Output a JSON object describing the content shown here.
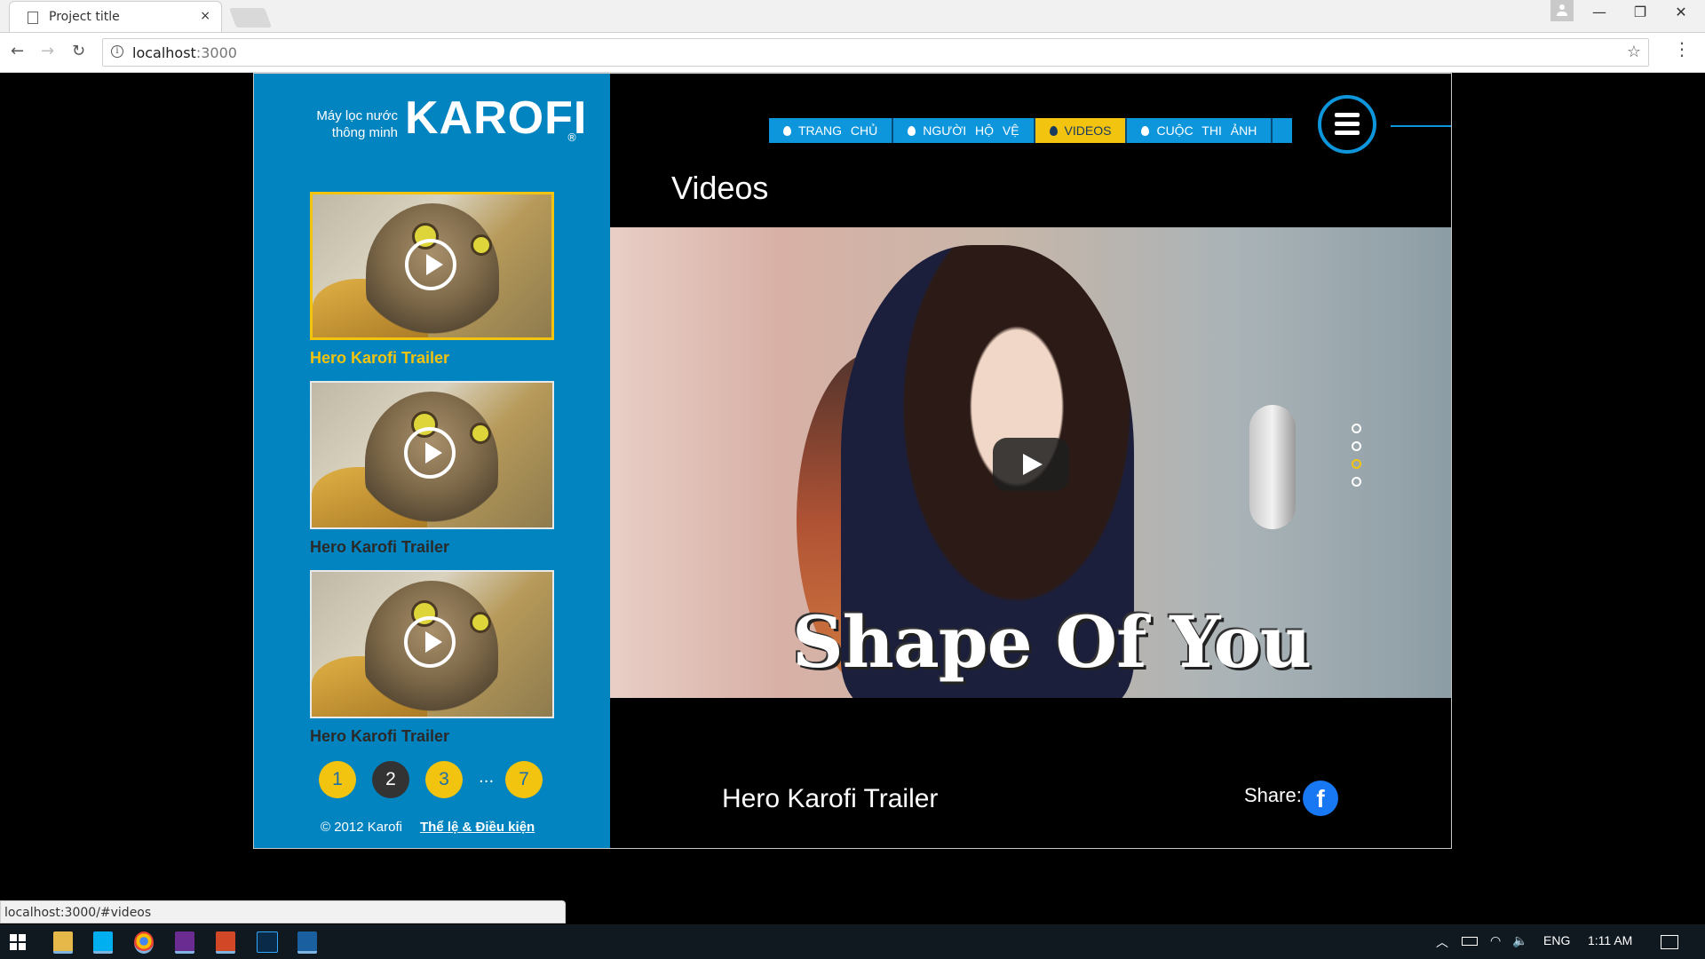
{
  "browser": {
    "tab_title": "Project title",
    "tab_close": "×",
    "url_host": "localhost",
    "url_port": ":3000",
    "win_minimize": "—",
    "win_restore": "❐",
    "win_close": "✕",
    "back": "←",
    "forward": "→",
    "reload": "↻",
    "star": "☆",
    "menu": "⋮",
    "status_url": "localhost:3000/#videos"
  },
  "logo": {
    "sub_line1": "Máy lọc nước",
    "sub_line2": "thông minh",
    "brand": "KAROFI",
    "reg": "®"
  },
  "sidebar": {
    "videos": [
      {
        "caption": "Hero Karofi Trailer",
        "active": true
      },
      {
        "caption": "Hero Karofi Trailer",
        "active": false
      },
      {
        "caption": "Hero Karofi Trailer",
        "active": false
      }
    ],
    "pagination": {
      "pages": [
        "1",
        "2",
        "3",
        "7"
      ],
      "current": "2",
      "ellipsis": "..."
    },
    "footer": {
      "copyright": "© 2012 Karofi",
      "terms_link": "Thể lệ & Điều kiện"
    }
  },
  "nav": {
    "items": [
      {
        "label": "TRANG CHỦ",
        "active": false
      },
      {
        "label": "NGƯỜI HỘ VỆ",
        "active": false
      },
      {
        "label": "VIDEOS",
        "active": true
      },
      {
        "label": "CUỘC THI ẢNH",
        "active": false
      }
    ]
  },
  "main": {
    "section_title": "Videos",
    "video_overlay_text": "Shape Of You",
    "video_title": "Hero Karofi Trailer",
    "share_label": "Share:",
    "facebook_glyph": "f",
    "slide_dots": 4,
    "active_slide": 3
  },
  "taskbar": {
    "language": "ENG",
    "time": "1:11 AM"
  },
  "colors": {
    "sidebar_blue": "#0284c0",
    "accent_yellow": "#f2c30f",
    "nav_blue": "#0e96dd",
    "facebook_blue": "#1877f2"
  }
}
